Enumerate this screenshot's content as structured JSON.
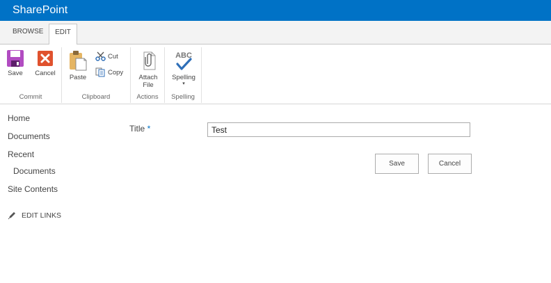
{
  "app": {
    "brand": "SharePoint"
  },
  "tabs": [
    {
      "label": "BROWSE",
      "selected": false
    },
    {
      "label": "EDIT",
      "selected": true
    }
  ],
  "ribbon": {
    "commit": {
      "label": "Commit",
      "save": "Save",
      "cancel": "Cancel"
    },
    "clipboard": {
      "label": "Clipboard",
      "paste": "Paste",
      "cut": "Cut",
      "copy": "Copy"
    },
    "actions": {
      "label": "Actions",
      "attach_line1": "Attach",
      "attach_line2": "File"
    },
    "spelling": {
      "label": "Spelling",
      "button": "Spelling",
      "icon_text": "ABC"
    }
  },
  "nav": {
    "items": [
      "Home",
      "Documents",
      "Recent",
      "Documents",
      "Site Contents"
    ],
    "edit_links": "EDIT LINKS"
  },
  "form": {
    "title_label": "Title",
    "required_marker": "*",
    "title_value": "Test",
    "save": "Save",
    "cancel": "Cancel"
  },
  "colors": {
    "suite_bar": "#0072c6",
    "save_icon": "#b14cc1",
    "cancel_icon": "#e0522e",
    "spell_check": "#2f6fb8"
  }
}
